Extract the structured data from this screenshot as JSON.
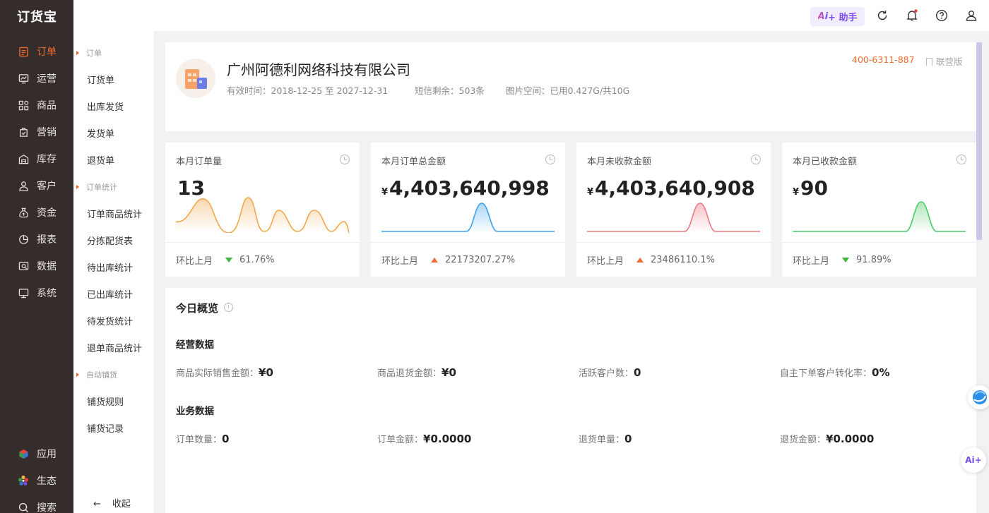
{
  "app": {
    "logo": "订货宝"
  },
  "nav": {
    "items": [
      {
        "label": "订单",
        "icon": "order-icon"
      },
      {
        "label": "运营",
        "icon": "operation-icon"
      },
      {
        "label": "商品",
        "icon": "goods-icon"
      },
      {
        "label": "营销",
        "icon": "marketing-icon"
      },
      {
        "label": "库存",
        "icon": "warehouse-icon"
      },
      {
        "label": "客户",
        "icon": "customer-icon"
      },
      {
        "label": "资金",
        "icon": "money-bag-icon"
      },
      {
        "label": "报表",
        "icon": "pie-chart-icon"
      },
      {
        "label": "数据",
        "icon": "data-icon"
      },
      {
        "label": "系统",
        "icon": "monitor-icon"
      }
    ],
    "bottom": [
      {
        "label": "应用",
        "icon": "app-cube-icon"
      },
      {
        "label": "生态",
        "icon": "ecology-flower-icon"
      },
      {
        "label": "搜索",
        "icon": "search-icon"
      }
    ],
    "active_color": "#ef6b2c"
  },
  "subnav": {
    "sections": [
      {
        "title": "订单",
        "items": [
          "订货单",
          "出库发货",
          "发货单",
          "退货单"
        ]
      },
      {
        "title": "订单统计",
        "items": [
          "订单商品统计",
          "分拣配货表",
          "待出库统计",
          "已出库统计",
          "待发货统计",
          "退单商品统计"
        ]
      },
      {
        "title": "自动铺货",
        "items": [
          "铺货规则",
          "铺货记录"
        ]
      }
    ],
    "collapse_label": "收起",
    "collapse_arrow": "←"
  },
  "topbar": {
    "ai_label_prefix": "Ai",
    "ai_label": "+ 助手",
    "icons": [
      "refresh-icon",
      "bell-icon",
      "help-icon",
      "user-icon"
    ]
  },
  "company": {
    "name": "广州阿德利网络科技有限公司",
    "validity": "有效时间：2018-12-25 至 2027-12-31",
    "sms": "短信剩余：503条",
    "storage": "图片空间：已用0.427G/共10G",
    "phone": "400-6311-887",
    "edition": "联营版"
  },
  "cards": [
    {
      "title": "本月订单量",
      "value": "13",
      "currency": "",
      "compare_label": "环比上月",
      "trend": "down",
      "change": "61.76%",
      "color": "#f2a74a"
    },
    {
      "title": "本月订单总金额",
      "value": "4,403,640,998",
      "currency": "¥",
      "compare_label": "环比上月",
      "trend": "up",
      "change": "22173207.27%",
      "color": "#3ea4ea"
    },
    {
      "title": "本月未收款金额",
      "value": "4,403,640,908",
      "currency": "¥",
      "compare_label": "环比上月",
      "trend": "up",
      "change": "23486110.1%",
      "color": "#ec7a84"
    },
    {
      "title": "本月已收款金额",
      "value": "90",
      "currency": "¥",
      "compare_label": "环比上月",
      "trend": "down",
      "change": "91.89%",
      "color": "#4cc766"
    }
  ],
  "overview": {
    "title": "今日概览",
    "business": {
      "title": "经营数据",
      "stats": [
        {
          "label": "商品实际销售金额：",
          "value": "¥0"
        },
        {
          "label": "商品退货金额：",
          "value": "¥0"
        },
        {
          "label": "活跃客户数：",
          "value": "0"
        },
        {
          "label": "自主下单客户转化率：",
          "value": "0%"
        }
      ]
    },
    "operations": {
      "title": "业务数据",
      "stats": [
        {
          "label": "订单数量：",
          "value": "0"
        },
        {
          "label": "订单金额：",
          "value": "¥0.0000"
        },
        {
          "label": "退货单量：",
          "value": "0"
        },
        {
          "label": "退货金额：",
          "value": "¥0.0000"
        }
      ]
    }
  },
  "float": {
    "ai_label": "Ai+"
  }
}
